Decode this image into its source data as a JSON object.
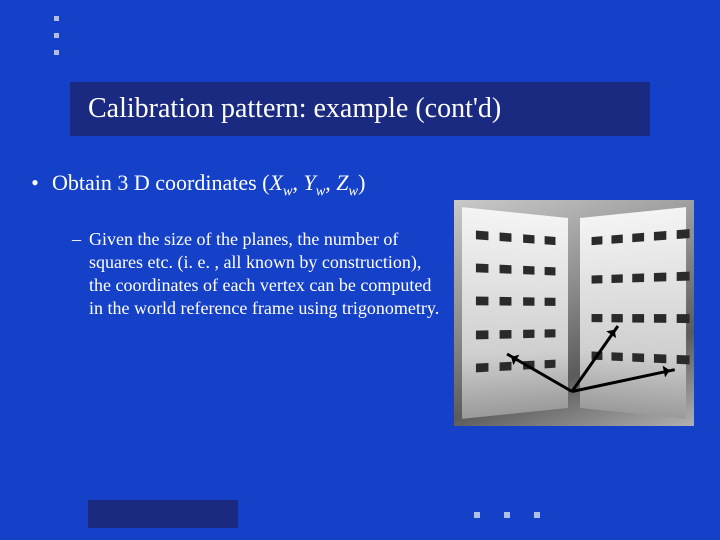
{
  "title": "Calibration pattern: example (cont'd)",
  "bullet": {
    "marker": "•",
    "text_pre": "Obtain 3 D coordinates (",
    "X": "X",
    "Xs": "w",
    "sep1": ", ",
    "Y": "Y",
    "Ys": "w",
    "sep2": ", ",
    "Z": "Z",
    "Zs": "w",
    "text_post": ")"
  },
  "sub": {
    "marker": "–",
    "text": "Given the size of the planes, the number of squares etc. (i. e. , all known by construction), the coordinates of each vertex can be computed in the world reference frame using trigonometry."
  },
  "figure": {
    "alt": "Two angled calibration planes with dark square grids and coordinate-axis arrows"
  }
}
